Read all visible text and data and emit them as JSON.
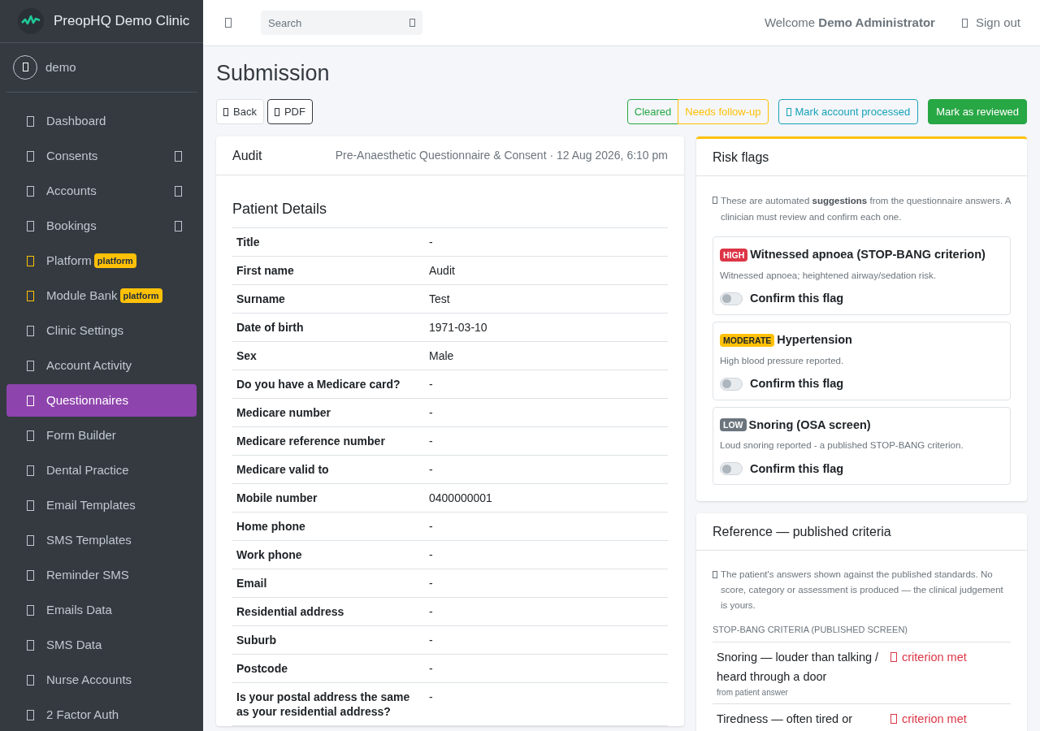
{
  "brand": {
    "name": "PreopHQ Demo Clinic"
  },
  "user": {
    "name": "demo"
  },
  "sidebar": {
    "items": [
      {
        "label": "Dashboard",
        "selected": false,
        "expandable": false
      },
      {
        "label": "Consents",
        "selected": false,
        "expandable": true
      },
      {
        "label": "Accounts",
        "selected": false,
        "expandable": true
      },
      {
        "label": "Bookings",
        "selected": false,
        "expandable": true
      },
      {
        "label": "Platform",
        "selected": false,
        "expandable": false,
        "badge": "platform"
      },
      {
        "label": "Module Bank",
        "selected": false,
        "expandable": false,
        "badge": "platform"
      },
      {
        "label": "Clinic Settings",
        "selected": false,
        "expandable": false
      },
      {
        "label": "Account Activity",
        "selected": false,
        "expandable": false
      },
      {
        "label": "Questionnaires",
        "selected": true,
        "expandable": false
      },
      {
        "label": "Form Builder",
        "selected": false,
        "expandable": false
      },
      {
        "label": "Dental Practice",
        "selected": false,
        "expandable": false
      },
      {
        "label": "Email Templates",
        "selected": false,
        "expandable": false
      },
      {
        "label": "SMS Templates",
        "selected": false,
        "expandable": false
      },
      {
        "label": "Reminder SMS",
        "selected": false,
        "expandable": false
      },
      {
        "label": "Emails Data",
        "selected": false,
        "expandable": false
      },
      {
        "label": "SMS Data",
        "selected": false,
        "expandable": false
      },
      {
        "label": "Nurse Accounts",
        "selected": false,
        "expandable": false
      },
      {
        "label": "2 Factor Auth",
        "selected": false,
        "expandable": false
      }
    ]
  },
  "topbar": {
    "search": {
      "placeholder": "Search"
    },
    "welcome": "Welcome **Demo Administrator**",
    "sign_out": "Sign out"
  },
  "page": {
    "title": "Submission",
    "left_actions": [
      {
        "label": "Back",
        "kind": "light"
      },
      {
        "label": "PDF",
        "kind": "dark"
      }
    ],
    "status_toggle": [
      {
        "label": "Cleared",
        "color": "#28a745"
      },
      {
        "label": "Needs follow-up",
        "color": "#ffc107"
      }
    ],
    "right_actions": [
      {
        "label": "Mark account processed",
        "kind": "outline-info"
      },
      {
        "label": "Mark as reviewed",
        "kind": "success"
      }
    ]
  },
  "submission": {
    "patient": "Audit",
    "meta": "Pre-Anaesthetic Questionnaire & Consent · 12 Aug 2026, 6:10 pm",
    "section": "Patient Details",
    "rows": [
      {
        "label": "Title",
        "value": "-"
      },
      {
        "label": "First name",
        "value": "Audit"
      },
      {
        "label": "Surname",
        "value": "Test"
      },
      {
        "label": "Date of birth",
        "value": "1971-03-10"
      },
      {
        "label": "Sex",
        "value": "Male"
      },
      {
        "label": "Do you have a Medicare card?",
        "value": "-"
      },
      {
        "label": "Medicare number",
        "value": "-"
      },
      {
        "label": "Medicare reference number",
        "value": "-"
      },
      {
        "label": "Medicare valid to",
        "value": "-"
      },
      {
        "label": "Mobile number",
        "value": "0400000001"
      },
      {
        "label": "Home phone",
        "value": "-"
      },
      {
        "label": "Work phone",
        "value": "-"
      },
      {
        "label": "Email",
        "value": "-"
      },
      {
        "label": "Residential address",
        "value": "-"
      },
      {
        "label": "Suburb",
        "value": "-"
      },
      {
        "label": "Postcode",
        "value": "-"
      },
      {
        "label": "Is your postal address the same as your residential address?",
        "value": "-"
      }
    ]
  },
  "risk_flags": {
    "title": "Risk flags",
    "intro": "These are automated **suggestions** from the questionnaire answers. A clinician must review and confirm each one.",
    "flags": [
      {
        "kind": "high",
        "badge": "HIGH",
        "title": "Witnessed apnoea (STOP-BANG criterion)",
        "description": "Witnessed apnoea; heightened airway/sedation risk.",
        "confirm_label": "Confirm this flag",
        "on": false
      },
      {
        "kind": "moderate",
        "badge": "MODERATE",
        "title": "Hypertension",
        "description": "High blood pressure reported.",
        "confirm_label": "Confirm this flag",
        "on": false
      },
      {
        "kind": "low",
        "badge": "LOW",
        "title": "Snoring (OSA screen)",
        "description": "Loud snoring reported - a published STOP-BANG criterion.",
        "confirm_label": "Confirm this flag",
        "on": false
      }
    ]
  },
  "reference": {
    "title": "Reference — published criteria",
    "intro": "The patient's answers shown against the published standards. No score, category or assessment is produced — the clinical judgement is yours.",
    "group": "STOP-BANG CRITERIA (PUBLISHED SCREEN)",
    "criteria": [
      {
        "name": "Snoring — louder than talking / heard through a door",
        "source": "from patient answer",
        "status": "criterion met"
      },
      {
        "name": "Tiredness — often tired or",
        "status": "criterion met"
      }
    ]
  }
}
